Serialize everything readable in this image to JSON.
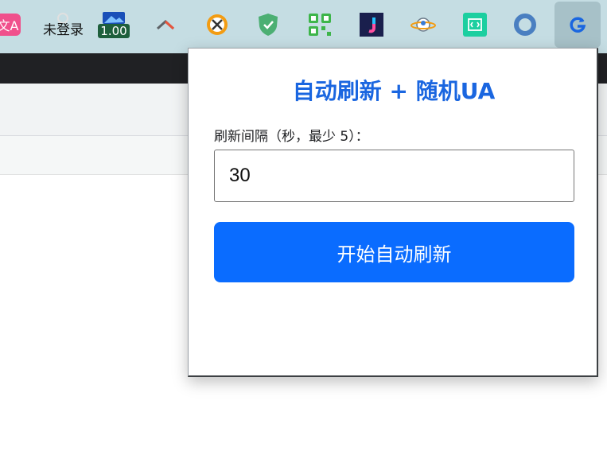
{
  "toolbar": {
    "extensions": [
      {
        "icon": "translate-icon",
        "color": "#f0508c"
      },
      {
        "icon": "not-logged-in-icon",
        "label": "未登录"
      },
      {
        "icon": "price-tag-icon",
        "badge": "1.00"
      },
      {
        "icon": "caret-up-icon"
      },
      {
        "icon": "no-sign-icon",
        "color": "#f39c12"
      },
      {
        "icon": "shield-check-icon",
        "color": "#4caf73"
      },
      {
        "icon": "qr-grid-icon",
        "color": "#3db54a"
      },
      {
        "icon": "j-logo-icon",
        "color": "#1a1f4d"
      },
      {
        "icon": "planet-icon"
      },
      {
        "icon": "code-box-icon",
        "color": "#1ccfa0"
      },
      {
        "icon": "ring-icon",
        "color": "#4a7fc1"
      },
      {
        "icon": "refresh-g-icon",
        "color": "#1a66e0",
        "active": true
      }
    ]
  },
  "popup": {
    "title": "自动刷新 + 随机UA",
    "interval_label": "刷新间隔（秒，最少 5）：",
    "interval_value": "30",
    "start_label": "开始自动刷新"
  },
  "colors": {
    "accent": "#0a6cff",
    "title": "#1a66e0",
    "toolbar_bg": "#c5dde3",
    "dark_bar": "#202124"
  }
}
